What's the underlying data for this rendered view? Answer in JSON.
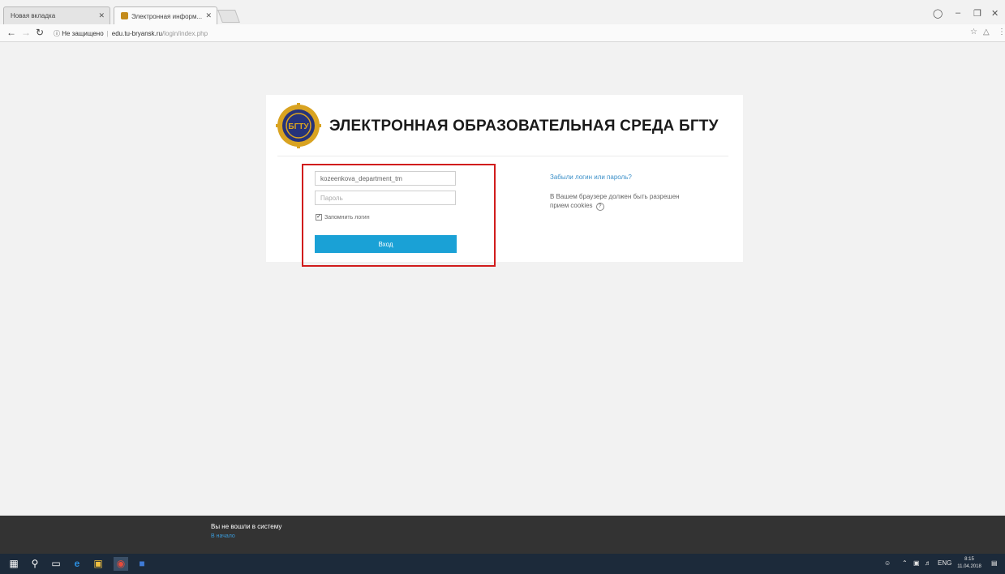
{
  "browser": {
    "tabs": [
      {
        "title": "Новая вкладка"
      },
      {
        "title": "Электронная информ..."
      }
    ],
    "close_glyph": "✕",
    "address": {
      "security": "Не защищено",
      "host": "edu.tu-bryansk.ru",
      "path": "/login/index.php"
    }
  },
  "card": {
    "title": "ЭЛЕКТРОННАЯ ОБРАЗОВАТЕЛЬНАЯ СРЕДА БГТУ",
    "logo_text": "БГТУ"
  },
  "login": {
    "username_value": "kozeenkova_department_tm",
    "password_placeholder": "Пароль",
    "remember_label": "Запомнить логин",
    "remember_checked": true,
    "submit_label": "Вход"
  },
  "aside": {
    "forgot_link": "Забыли логин или пароль?",
    "cookies_text": "В Вашем браузере должен быть разрешен прием cookies",
    "help_glyph": "?"
  },
  "footer": {
    "status": "Вы не вошли в систему",
    "home_link": "В начало"
  },
  "taskbar": {
    "language": "ENG",
    "time": "8:15",
    "date": "11.04.2018"
  },
  "colors": {
    "accent": "#1aa1d6",
    "highlight_border": "#d11c1c",
    "link": "#3a8fc8",
    "footer_bg": "#333333"
  }
}
